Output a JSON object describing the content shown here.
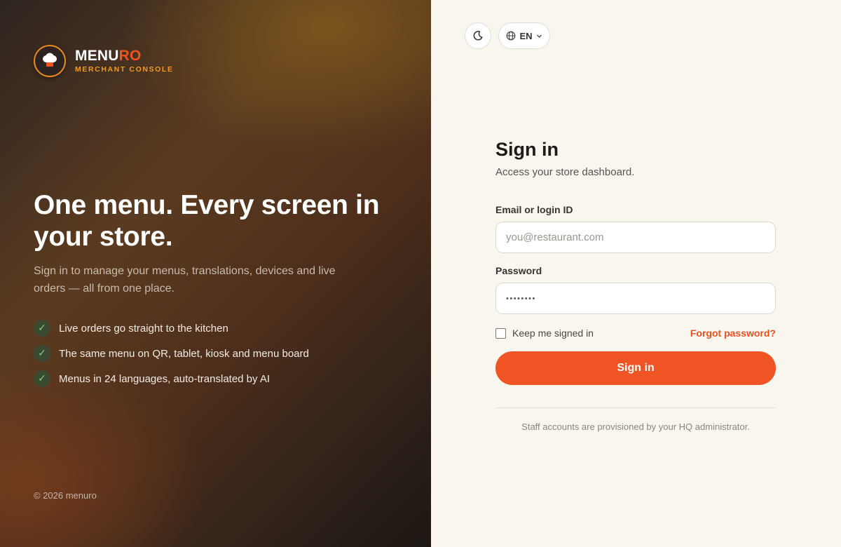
{
  "brand": {
    "name_part1": "MENU",
    "name_part2": "RO",
    "tagline": "MERCHANT CONSOLE",
    "icon": "chef-hat-icon"
  },
  "hero": {
    "title": "One menu. Every screen in your store.",
    "description": "Sign in to manage your menus, translations, devices and live orders — all from one place.",
    "features": [
      {
        "icon": "check-icon",
        "text": "Live orders go straight to the kitchen"
      },
      {
        "icon": "check-icon",
        "text": "The same menu on QR, tablet, kiosk and menu board"
      },
      {
        "icon": "check-icon",
        "text": "Menus in 24 languages, auto-translated by AI"
      }
    ],
    "copyright": "© 2026 menuro"
  },
  "topbar": {
    "theme_icon": "moon-icon",
    "language_icon": "globe-icon",
    "language": "EN",
    "language_chevron": "chevron-down-icon"
  },
  "form": {
    "title": "Sign in",
    "subtitle": "Access your store dashboard.",
    "email_label": "Email or login ID",
    "email_placeholder": "you@restaurant.com",
    "password_label": "Password",
    "password_value": "••••••••",
    "remember_label": "Keep me signed in",
    "remember_checked": false,
    "forgot_label": "Forgot password?",
    "submit_label": "Sign in",
    "footer_note": "Staff accounts are provisioned by your HQ administrator."
  },
  "colors": {
    "accent": "#f05324",
    "brand_orange": "#f09a22",
    "check_green": "#7fd17a",
    "right_panel_bg": "#f9f6f0"
  }
}
